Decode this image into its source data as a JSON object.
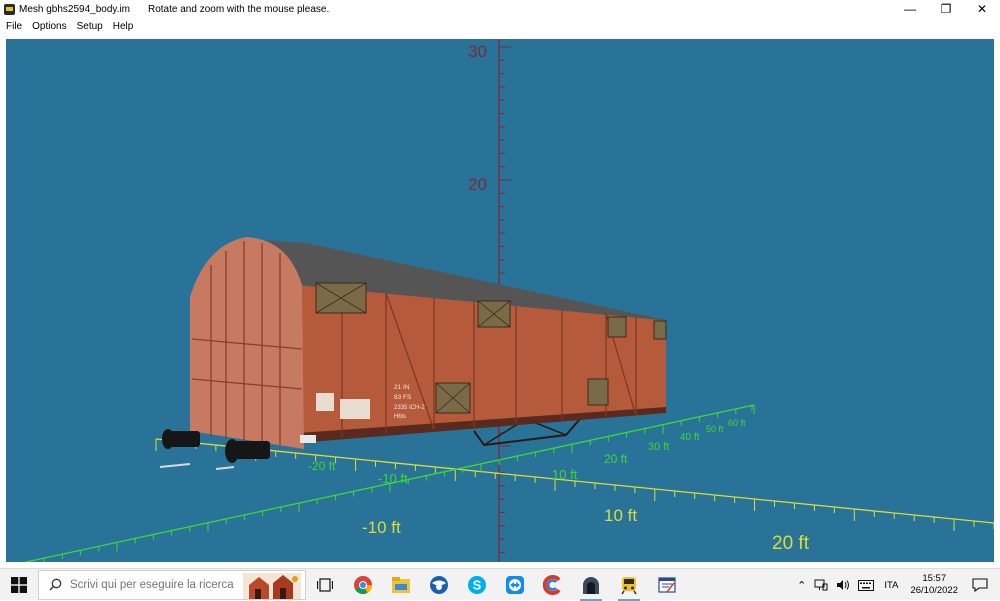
{
  "window": {
    "title": "Mesh gbhs2594_body.im",
    "hint": "Rotate and zoom with the mouse please.",
    "controls": {
      "minimize": "—",
      "restore": "❐",
      "close": "✕"
    }
  },
  "menu": {
    "items": [
      "File",
      "Options",
      "Setup",
      "Help"
    ]
  },
  "scene": {
    "background_color": "#2a7398",
    "vertical_axis_color": "#7a2a3a",
    "near_axis_color": "#d8dd3a",
    "far_axis_color": "#3ad83a",
    "vertical_labels": [
      "30",
      "20"
    ],
    "near_axis_labels": [
      "-10 ft",
      "10 ft",
      "20 ft"
    ],
    "far_axis_labels": [
      "-20 ft",
      "-10 ft",
      "10 ft",
      "20 ft",
      "30 ft",
      "40 ft",
      "50 ft",
      "60 ft"
    ],
    "wagon_markings": [
      "21 IN",
      "83 FS",
      "2335 ICH-2",
      "Hbis"
    ]
  },
  "taskbar": {
    "search_placeholder": "Scrivi qui per eseguire la ricerca",
    "language": "ITA",
    "time": "15:57",
    "date": "26/10/2022"
  }
}
